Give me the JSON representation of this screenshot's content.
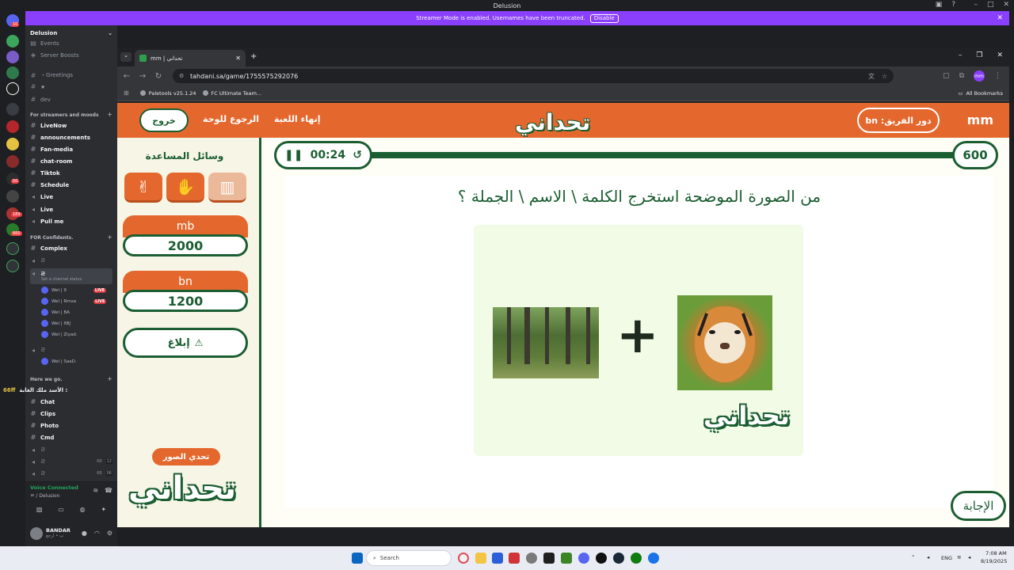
{
  "discord": {
    "window_title": "Delusion",
    "streamer_banner": {
      "text": "Streamer Mode is enabled. Usernames have been truncated.",
      "disable_label": "Disable"
    },
    "server_badges": [
      "10",
      "50",
      "189",
      "660"
    ],
    "server_name": "Delusion",
    "channels_top": [
      {
        "label": "Events",
        "type": "text"
      },
      {
        "label": "Server Boosts",
        "type": "boost"
      },
      {
        "label": "・Greetings",
        "type": "text"
      },
      {
        "label": "★",
        "type": "text"
      },
      {
        "label": "dev",
        "type": "text"
      }
    ],
    "category_streamers": "For streamers and moods",
    "channels_streamers": [
      {
        "label": "LiveNow"
      },
      {
        "label": "announcements"
      },
      {
        "label": "Fan-media"
      },
      {
        "label": "chat-room"
      },
      {
        "label": "Tiktok"
      },
      {
        "label": "Schedule"
      },
      {
        "label": "Live"
      },
      {
        "label": "Live"
      },
      {
        "label": "Pull me"
      }
    ],
    "category_confidents": "FOR Confidents.",
    "channels_confidents": [
      "Complex",
      "ㄹ",
      "ㄹ"
    ],
    "channel_status": "Set a channel status",
    "voice_users": [
      {
        "name": "Wel | 9",
        "live": "LIVE"
      },
      {
        "name": "Wel | Nmsa",
        "live": "LIVE"
      },
      {
        "name": "Wel | BA",
        "live": ""
      },
      {
        "name": "Wel | IIBJ",
        "live": ""
      },
      {
        "name": "Wel | Ziyad.",
        "live": ""
      }
    ],
    "voice_channel_2": "ㄹ",
    "voice_user_2": "Wel | SaaD.",
    "category_here": "Here we go.",
    "here_banner": "الأسد ملك الغابة :",
    "here_prefix": "66ff",
    "channels_here": [
      "Chat",
      "Clips",
      "Photo",
      "Cmd",
      "ㄹ",
      "ㄹ",
      "ㄹ"
    ],
    "voice_counts": [
      "00",
      "12",
      "00",
      "06"
    ],
    "voice_connected": "Voice Connected",
    "voice_location": "ㄹ / Delusion",
    "user_name": "BANDAR",
    "user_status": "ب • ارجع"
  },
  "chrome": {
    "tab_title": "mm | تحداني",
    "url": "tahdani.sa/game/1755575292076",
    "bookmarks": [
      "Paletools v25.1.24",
      "FC Ultimate Team..."
    ],
    "all_bookmarks": "All Bookmarks",
    "profile_initials": "mm"
  },
  "game": {
    "team_header": "mm",
    "turn_label": "دور الفريق: bn",
    "exit_label": "خروج",
    "back_label": "الرجوع للوحة",
    "end_game_label": "إنهاء اللعبة",
    "logo_text": "تحداني",
    "help_title": "وسائل المساعدة",
    "help_icons": [
      "peace-hand-icon",
      "raised-hand-icon",
      "open-book-icon"
    ],
    "teams": [
      {
        "name": "mb",
        "score": "2000"
      },
      {
        "name": "bn",
        "score": "1200"
      }
    ],
    "report_label": "إبلاغ",
    "category_label": "تحدي الصور",
    "timer": "00:24",
    "points": "600",
    "question": "من الصورة الموضحة استخرج الكلمة \\ الاسم \\ الجملة ؟",
    "plus": "+",
    "puzzle_images": [
      "forest-image",
      "tiger-image"
    ],
    "answer_label": "الإجابة",
    "colors": {
      "orange": "#e4682e",
      "green": "#1b5e32",
      "cream": "#fefdf6"
    }
  },
  "taskbar": {
    "search_placeholder": "Search",
    "lang": "ENG",
    "time": "7:08 AM",
    "date": "8/19/2025"
  }
}
